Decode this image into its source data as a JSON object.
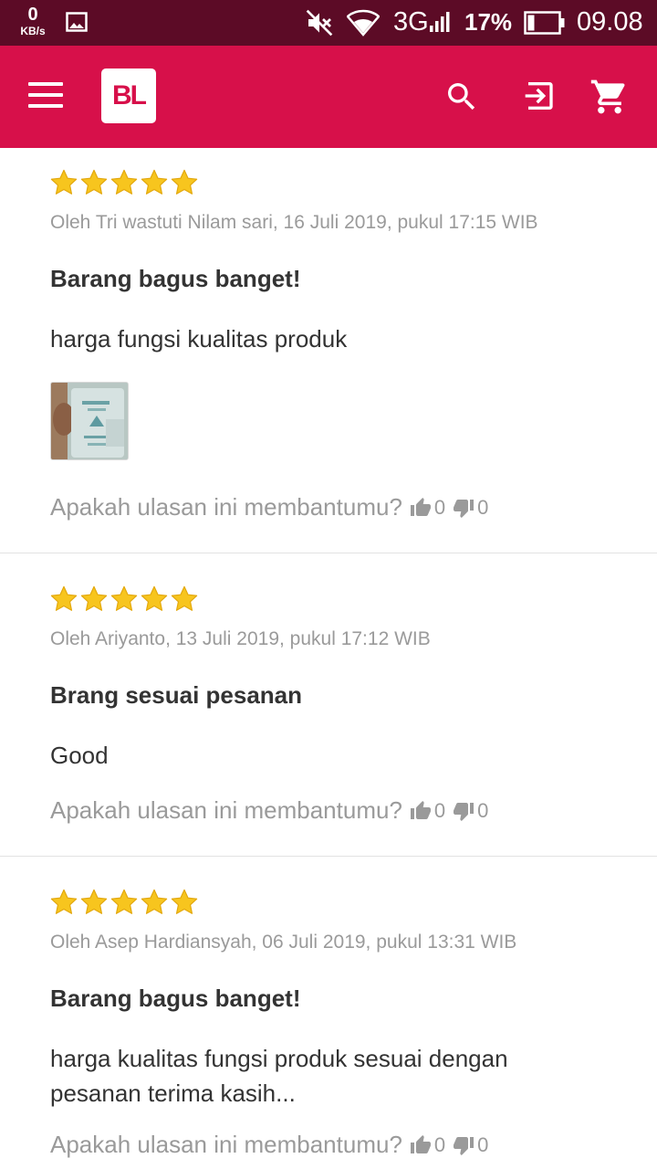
{
  "status_bar": {
    "net_speed_value": "0",
    "net_speed_unit": "KB/s",
    "network_type": "3G",
    "battery_percent": "17%",
    "time": "09.08"
  },
  "app_bar": {
    "logo_text": "BL",
    "brand_color": "#d7104a",
    "icons": [
      "menu-icon",
      "search-icon",
      "login-icon",
      "cart-icon"
    ]
  },
  "reviews": [
    {
      "rating": 5,
      "meta": "Oleh Tri wastuti Nilam sari, 16 Juli 2019, pukul 17:15 WIB",
      "title": "Barang bagus banget!",
      "body": "harga fungsi kualitas produk",
      "has_photo": true,
      "helpful_question": "Apakah ulasan ini membantumu?",
      "likes": "0",
      "dislikes": "0"
    },
    {
      "rating": 5,
      "meta": "Oleh Ariyanto, 13 Juli 2019, pukul 17:12 WIB",
      "title": "Brang sesuai pesanan",
      "body": "Good",
      "has_photo": false,
      "helpful_question": "Apakah ulasan ini membantumu?",
      "likes": "0",
      "dislikes": "0"
    },
    {
      "rating": 5,
      "meta": "Oleh Asep Hardiansyah, 06 Juli 2019, pukul 13:31 WIB",
      "title": "Barang bagus banget!",
      "body": "harga kualitas fungsi produk sesuai dengan pesanan terima kasih...",
      "has_photo": false,
      "helpful_question": "Apakah ulasan ini membantumu?",
      "likes": "0",
      "dislikes": "0"
    }
  ]
}
